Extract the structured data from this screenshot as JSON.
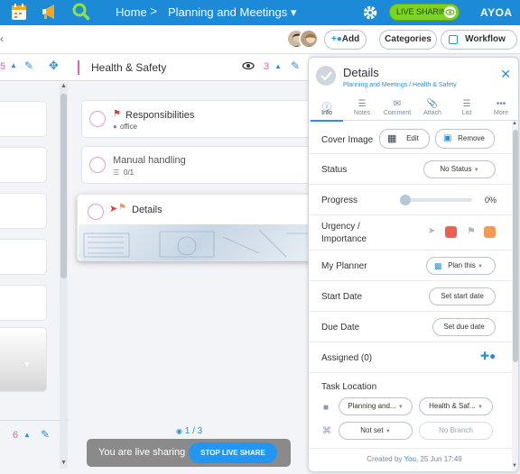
{
  "topbar": {
    "home": "Home",
    "breadcrumb_sep": ">",
    "project": "Planning and Meetings ▾",
    "live_label": "LIVE SHARING",
    "brand": "AYOA"
  },
  "toolbar": {
    "back": "‹",
    "add": "Add",
    "categories": "Categories",
    "workflow": "Workflow"
  },
  "left_col": {
    "count": "5"
  },
  "column": {
    "title": "Health & Safety",
    "count": "3",
    "pager": "1 / 3"
  },
  "bottom_left": {
    "count": "6"
  },
  "cards": [
    {
      "title": "Responsibilities",
      "tag": "office"
    },
    {
      "title": "Manual handling",
      "sub": "0/1"
    },
    {
      "title": "Details"
    }
  ],
  "panel": {
    "title": "Details",
    "breadcrumb": "Planning and Meetings / Health & Safety",
    "tabs": [
      "Info",
      "Notes",
      "Comment",
      "Attach",
      "List",
      "More"
    ],
    "cover_image": {
      "label": "Cover Image",
      "edit": "Edit",
      "remove": "Remove"
    },
    "status": {
      "label": "Status",
      "value": "No Status"
    },
    "progress": {
      "label": "Progress",
      "value": "0%",
      "fraction": 0
    },
    "urgency": {
      "label": "Urgency / Importance"
    },
    "planner": {
      "label": "My Planner",
      "value": "Plan this"
    },
    "start": {
      "label": "Start Date",
      "value": "Set start date"
    },
    "due": {
      "label": "Due Date",
      "value": "Set due date"
    },
    "assigned": {
      "label": "Assigned (0)"
    },
    "location": {
      "label": "Task Location",
      "board": "Planning and...",
      "list": "Health & Saf...",
      "group": "Not set",
      "branch": "No Branch"
    },
    "created": {
      "prefix": "Created by",
      "user": "You,",
      "date": "25 Jun 17:49"
    }
  },
  "share": {
    "text": "You are live sharing",
    "button": "STOP LIVE SHARE"
  },
  "colors": {
    "brand_blue": "#1d8ad8",
    "live_green": "#7ed321",
    "accent_pink": "#e05ec8",
    "urgency_red": "#f05e52",
    "importance_orange": "#f59a56"
  }
}
